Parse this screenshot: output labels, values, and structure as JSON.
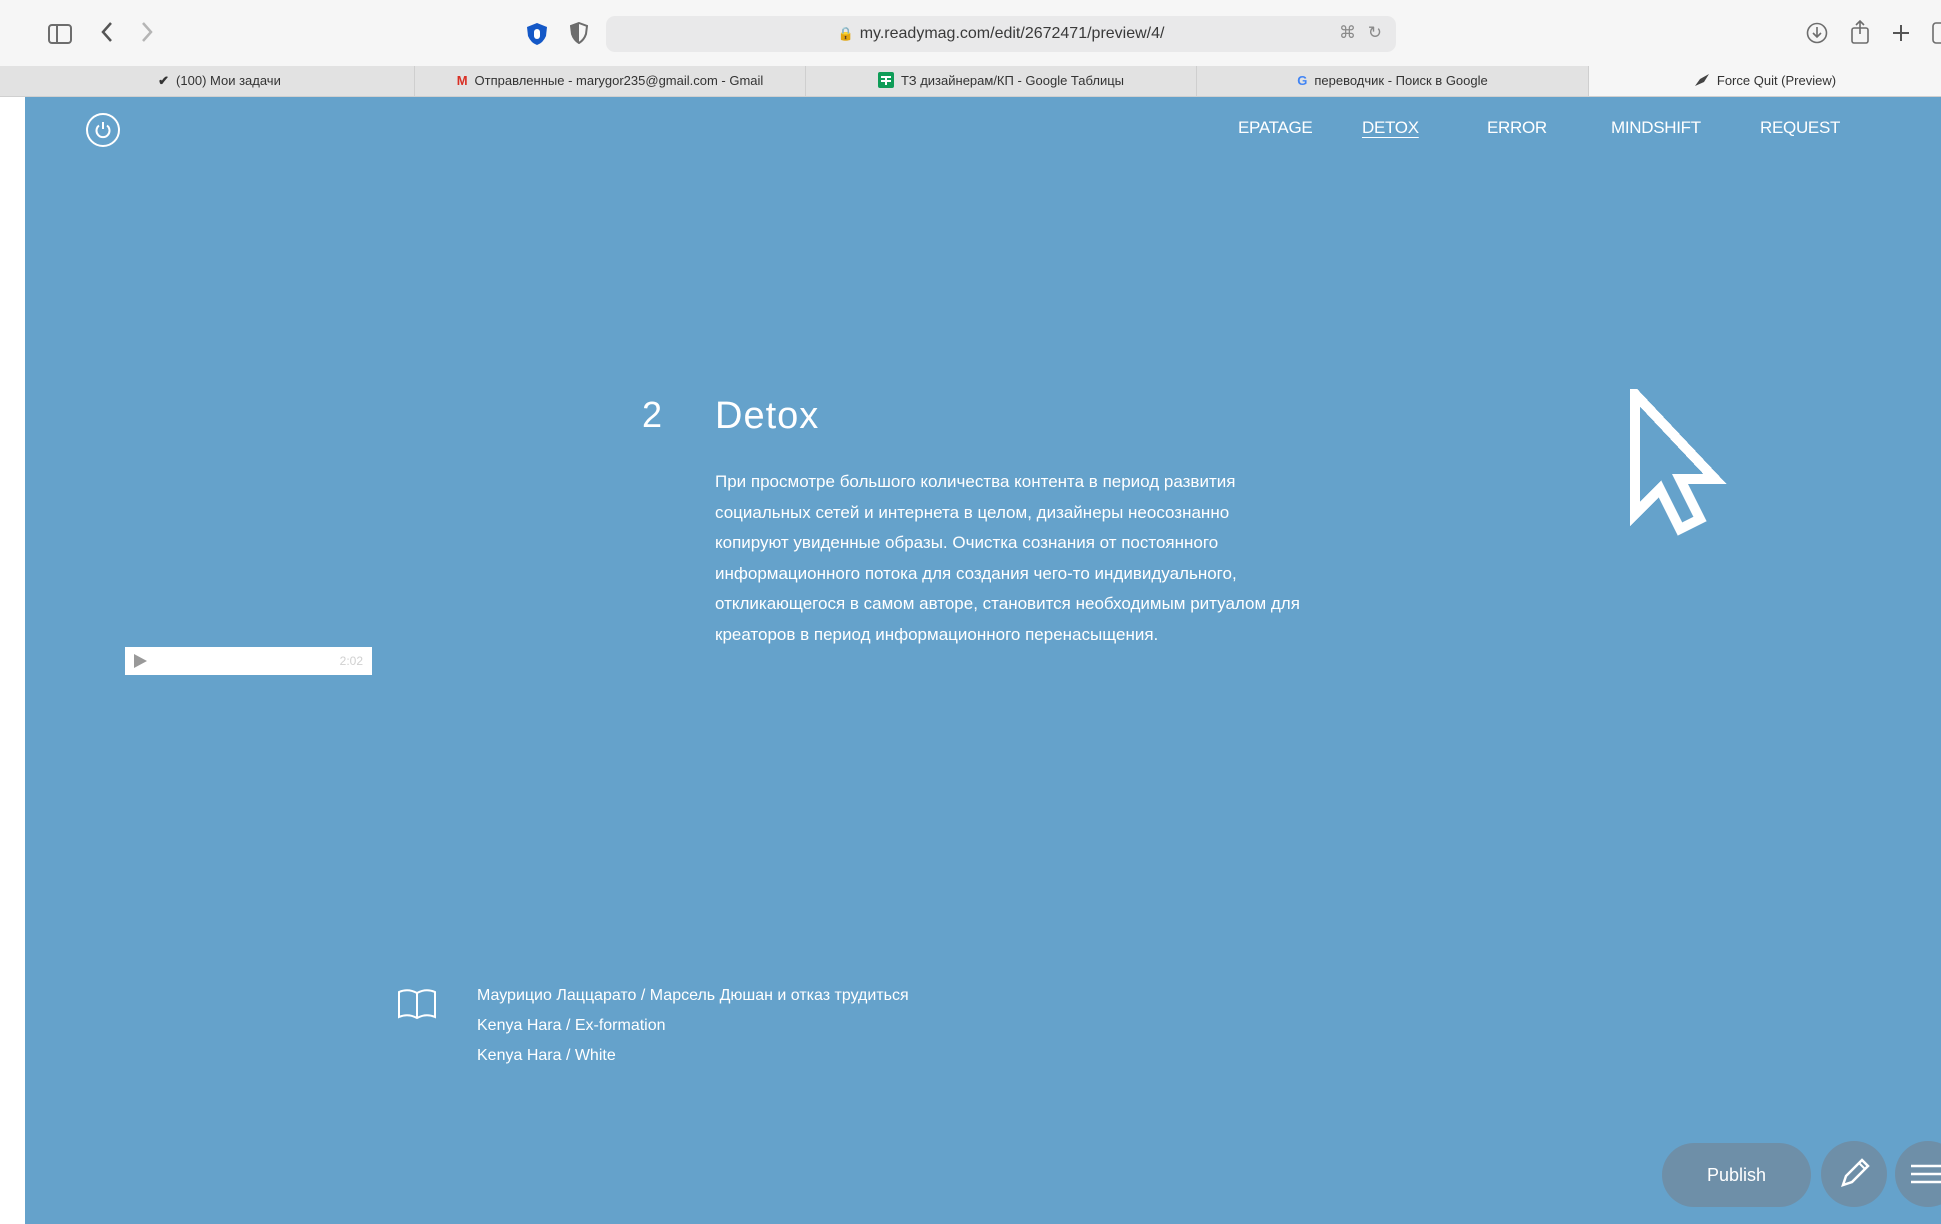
{
  "browser": {
    "url": "my.readymag.com/edit/2672471/preview/4/",
    "tabs": [
      {
        "label": "(100) Мои задачи",
        "icon": "checkmark-icon"
      },
      {
        "label": "Отправленные - marygor235@gmail.com - Gmail",
        "icon": "gmail-icon",
        "icon_text": "M",
        "icon_color": "#d93025"
      },
      {
        "label": "ТЗ дизайнерам/КП - Google Таблицы",
        "icon": "google-sheets-icon",
        "icon_color": "#0f9d58"
      },
      {
        "label": "переводчик - Поиск в Google",
        "icon": "google-icon",
        "icon_text": "G",
        "icon_color": "#4285f4"
      },
      {
        "label": "Force Quit (Preview)",
        "icon": "preview-icon",
        "active": true
      }
    ]
  },
  "page": {
    "background": "#65a2cb",
    "nav": [
      {
        "label": "EPATAGE"
      },
      {
        "label": "DETOX",
        "active": true
      },
      {
        "label": "ERROR"
      },
      {
        "label": "MINDSHIFT"
      },
      {
        "label": "REQUEST"
      }
    ],
    "section": {
      "number": "2",
      "title": "Detox",
      "body": "При просмотре большого количества контента в период развития социальных сетей и интернета в целом, дизайнеры неосознанно копируют увиденные образы. Очистка сознания от постоянного информационного потока для создания чего-то индивидуального, откликающегося в самом авторе, становится необходимым ритуалом для креаторов в период информационного перенасыщения."
    },
    "audio": {
      "time": "2:02"
    },
    "references": [
      "Маурицио Лаццарато / Марсель Дюшан и отказ трудиться",
      "Kenya Hara / Ex-formation",
      "Kenya Hara / White"
    ],
    "publish_label": "Publish"
  }
}
